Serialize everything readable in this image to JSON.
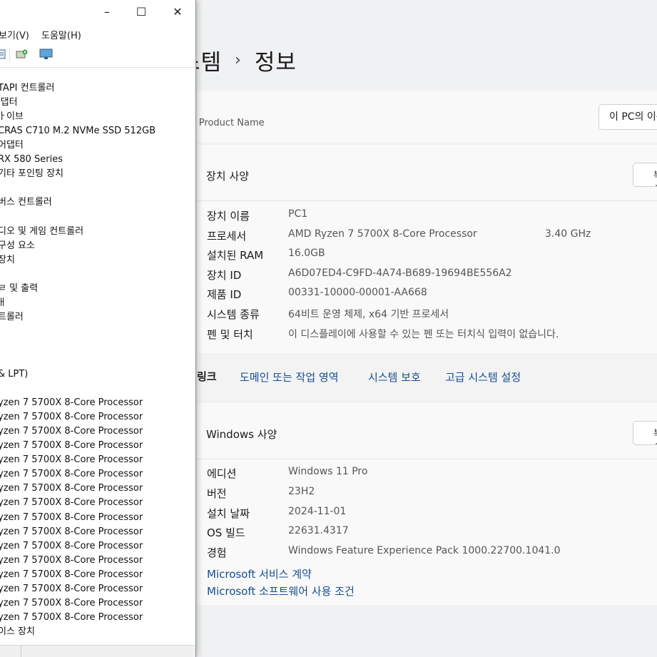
{
  "settings": {
    "breadcrumb_parent": "스템",
    "breadcrumb_sep": "›",
    "breadcrumb_current": "정보",
    "product_name": "m Product Name",
    "rename_button": "이 PC의 이름 바꾸기",
    "device_specs": {
      "title": "장치 사양",
      "copy_button": "복사",
      "rows": [
        {
          "key": "장치 이름",
          "value": "PC1",
          "extra": ""
        },
        {
          "key": "프로세서",
          "value": "AMD Ryzen 7 5700X 8-Core Processor",
          "extra": "3.40 GHz"
        },
        {
          "key": "설치된 RAM",
          "value": "16.0GB",
          "extra": ""
        },
        {
          "key": "장치 ID",
          "value": "A6D07ED4-C9FD-4A74-B689-19694BE556A2",
          "extra": ""
        },
        {
          "key": "제품 ID",
          "value": "00331-10000-00001-AA668",
          "extra": ""
        },
        {
          "key": "시스템 종류",
          "value": "64비트 운영 체제, x64 기반 프로세서",
          "extra": ""
        },
        {
          "key": "펜 및 터치",
          "value": "이 디스플레이에 사용할 수 있는 펜 또는 터치식 입력이 없습니다.",
          "extra": ""
        }
      ]
    },
    "related_links": {
      "label": "링크",
      "links": [
        "도메인 또는 작업 영역",
        "시스템 보호",
        "고급 시스템 설정"
      ]
    },
    "windows_specs": {
      "title": "Windows 사양",
      "copy_button": "복사",
      "rows": [
        {
          "key": "에디션",
          "value": "Windows 11 Pro"
        },
        {
          "key": "버전",
          "value": "23H2"
        },
        {
          "key": "설치 날짜",
          "value": "2024-11-01"
        },
        {
          "key": "OS 빌드",
          "value": "22631.4317"
        },
        {
          "key": "경험",
          "value": "Windows Feature Experience Pack 1000.22700.1041.0"
        }
      ],
      "links": [
        "Microsoft 서비스 계약",
        "Microsoft 소프트웨어 사용 조건"
      ]
    }
  },
  "device_manager": {
    "window_controls": {
      "minimize": "–",
      "maximize": "☐",
      "close": "✕"
    },
    "menu": [
      "보기(V)",
      "도움말(H)"
    ],
    "tree": [
      "TAPI 컨트롤러",
      "l댑터",
      "ㅏ이브",
      "CRAS C710 M.2 NVMe SSD 512GB",
      " 어댑터",
      " RX 580 Series",
      "기타 포인팅 장치",
      "",
      "버스 컨트롤러",
      "",
      "디오 및 게임 컨트롤러",
      " 구성 요소",
      " 장치",
      "l",
      "ㄹ 및 출력",
      "ㅐ",
      "트롤러",
      "",
      "",
      "",
      "& LPT)",
      "",
      "yzen 7 5700X 8-Core Processor",
      "yzen 7 5700X 8-Core Processor",
      "yzen 7 5700X 8-Core Processor",
      "yzen 7 5700X 8-Core Processor",
      "yzen 7 5700X 8-Core Processor",
      "yzen 7 5700X 8-Core Processor",
      "yzen 7 5700X 8-Core Processor",
      "yzen 7 5700X 8-Core Processor",
      "yzen 7 5700X 8-Core Processor",
      "yzen 7 5700X 8-Core Processor",
      "yzen 7 5700X 8-Core Processor",
      "yzen 7 5700X 8-Core Processor",
      "yzen 7 5700X 8-Core Processor",
      "yzen 7 5700X 8-Core Processor",
      "yzen 7 5700X 8-Core Processor",
      "yzen 7 5700X 8-Core Processor",
      "이스 장치"
    ]
  }
}
